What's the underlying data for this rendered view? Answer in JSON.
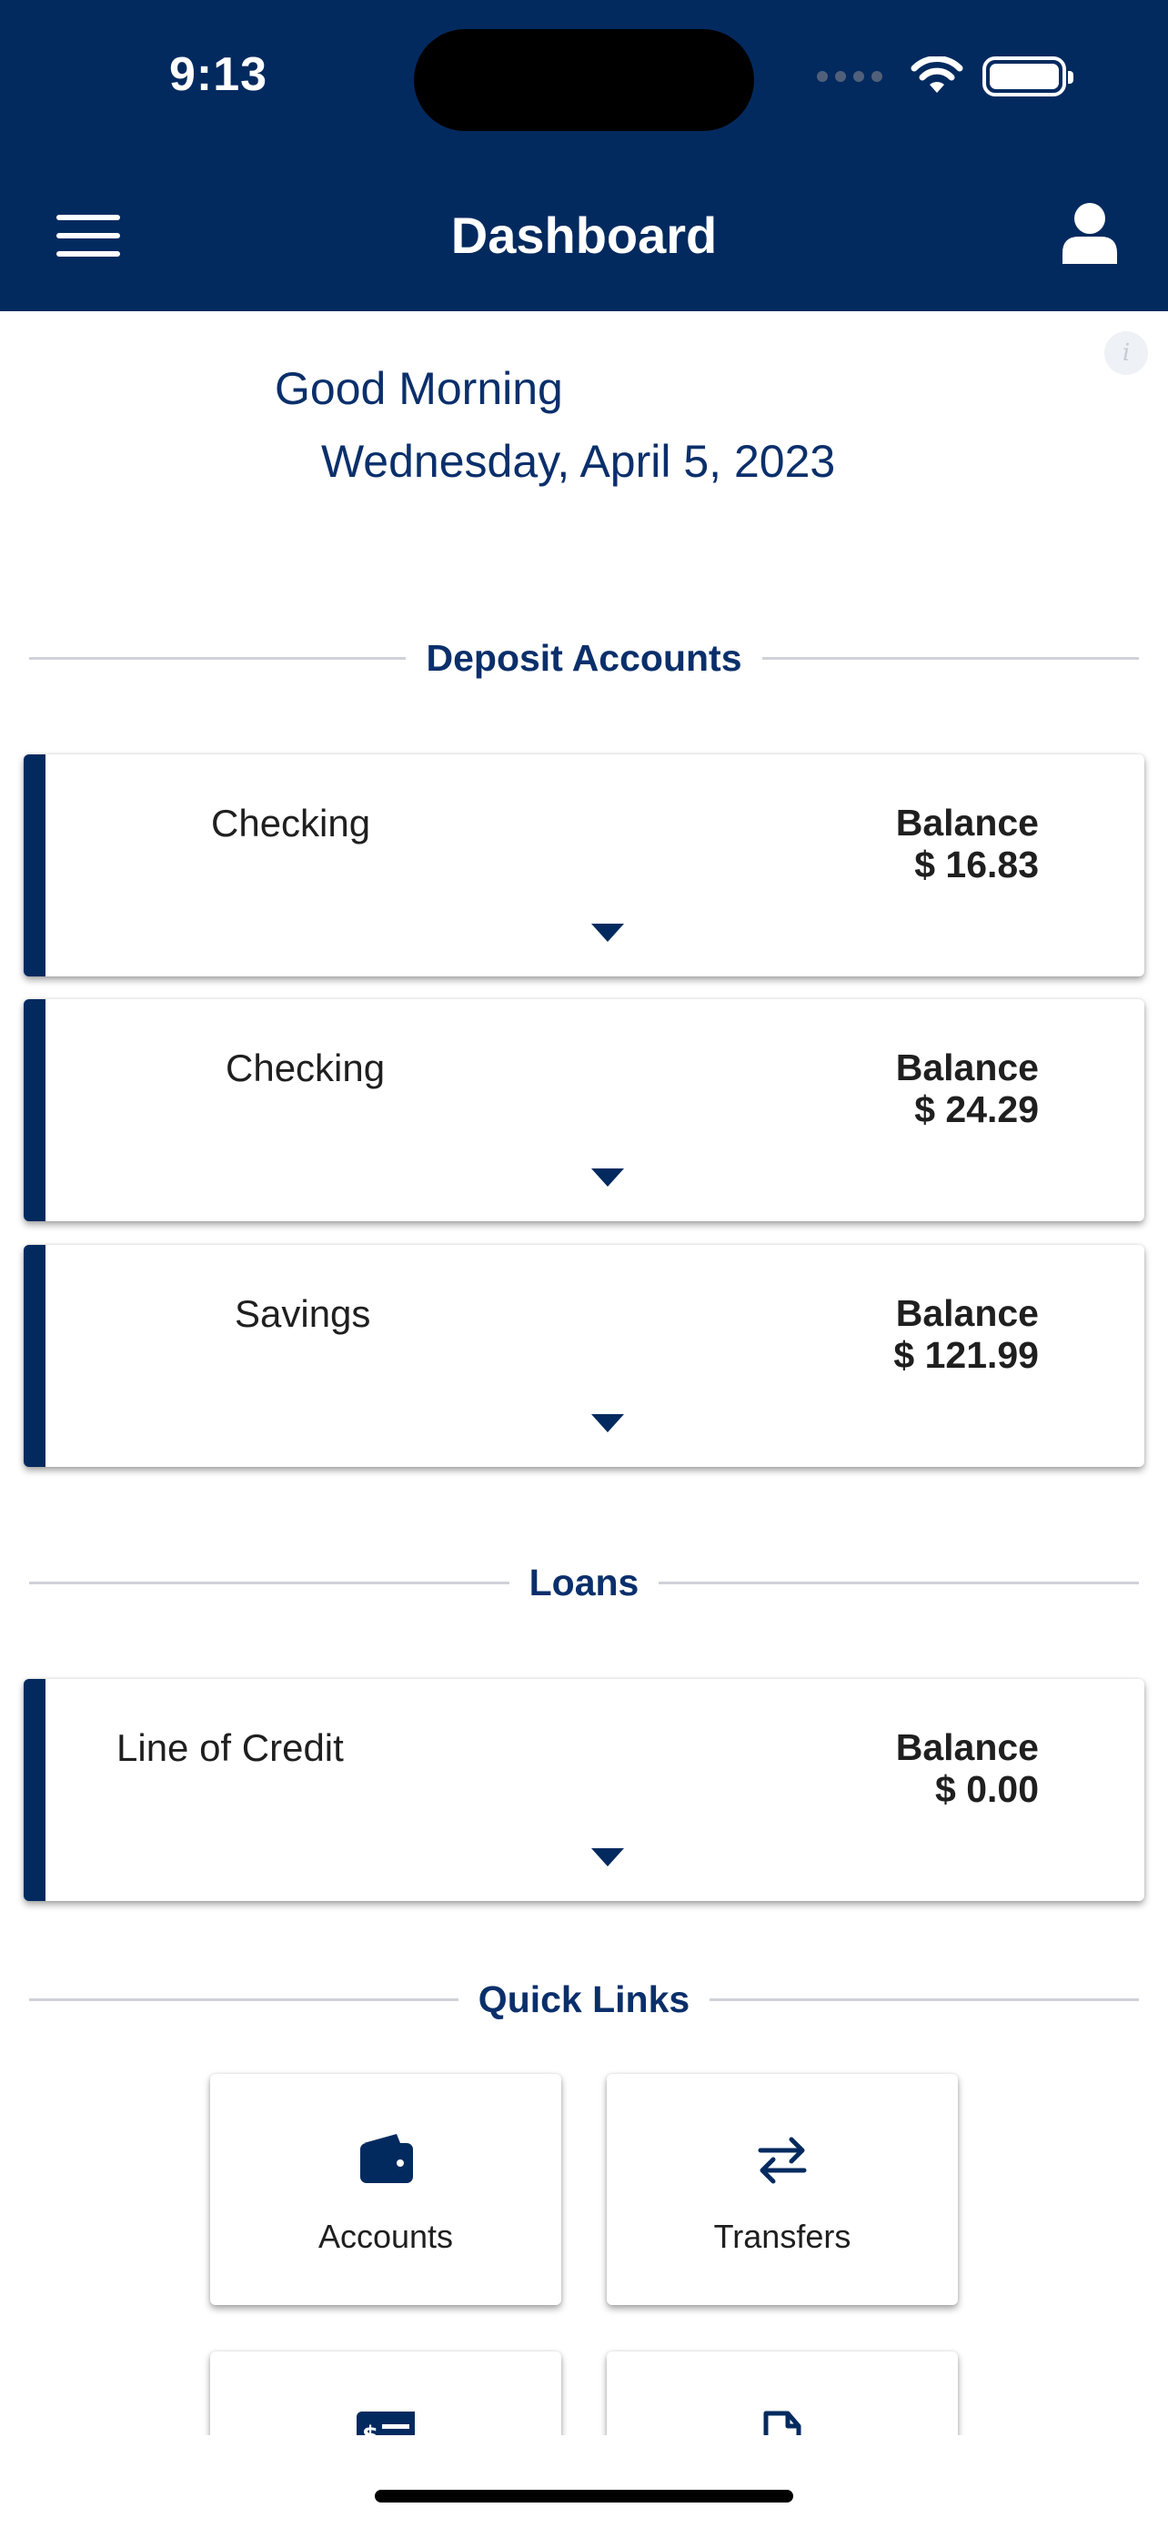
{
  "status_bar": {
    "time": "9:13"
  },
  "header": {
    "title": "Dashboard"
  },
  "greeting": {
    "text": "Good Morning",
    "date": "Wednesday, April 5, 2023"
  },
  "sections": {
    "deposit": "Deposit Accounts",
    "loans": "Loans",
    "quick_links": "Quick Links"
  },
  "deposit_accounts": [
    {
      "name": "Checking",
      "balance_label": "Balance",
      "balance": "$ 16.83"
    },
    {
      "name": "Checking",
      "balance_label": "Balance",
      "balance": "$ 24.29"
    },
    {
      "name": "Savings",
      "balance_label": "Balance",
      "balance": "$ 121.99"
    }
  ],
  "loans": [
    {
      "name": "Line of Credit",
      "balance_label": "Balance",
      "balance": "$ 0.00"
    }
  ],
  "quick_links": [
    {
      "label": "Accounts",
      "icon": "wallet-icon"
    },
    {
      "label": "Transfers",
      "icon": "transfer-arrows-icon"
    },
    {
      "label": "",
      "icon": "bill-pay-icon"
    },
    {
      "label": "",
      "icon": "document-icon"
    }
  ],
  "colors": {
    "header_bg": "#032a5f",
    "accent": "#0a2f6b",
    "divider": "#cfd2d8"
  }
}
